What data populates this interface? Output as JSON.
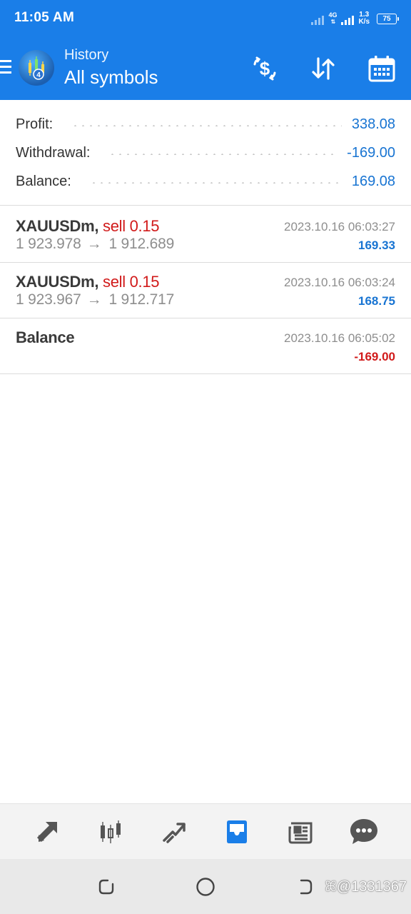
{
  "status_bar": {
    "time": "11:05 AM",
    "network": "4G",
    "speed_value": "1.3",
    "speed_unit": "K/s",
    "battery": "75"
  },
  "app_bar": {
    "subtitle": "History",
    "title": "All symbols",
    "icons": [
      "menu-icon",
      "app-logo",
      "deposit-dollar-icon",
      "sort-icon",
      "calendar-icon"
    ]
  },
  "summary": {
    "rows": [
      {
        "label": "Profit:",
        "value": "338.08"
      },
      {
        "label": "Withdrawal:",
        "value": "-169.00"
      },
      {
        "label": "Balance:",
        "value": "169.08"
      }
    ]
  },
  "deals": [
    {
      "symbol": "XAUUSDm,",
      "type": "sell 0.15",
      "open_price": "1 923.978",
      "arrow": "→",
      "close_price": "1 912.689",
      "time": "2023.10.16 06:03:27",
      "profit": "169.33"
    },
    {
      "symbol": "XAUUSDm,",
      "type": "sell 0.15",
      "open_price": "1 923.967",
      "arrow": "→",
      "close_price": "1 912.717",
      "time": "2023.10.16 06:03:24",
      "profit": "168.75"
    },
    {
      "symbol": "Balance",
      "type": "",
      "open_price": "",
      "arrow": "",
      "close_price": "",
      "time": "2023.10.16 06:05:02",
      "profit": "-169.00"
    }
  ],
  "bottom_nav": {
    "items": [
      "quotes-icon",
      "chart-icon",
      "trade-icon",
      "history-icon",
      "news-icon",
      "chat-icon"
    ],
    "active": "history-icon",
    "active_color": "#1a7ee8"
  },
  "system_nav": {
    "buttons": [
      "recent-apps-icon",
      "home-icon",
      "back-icon"
    ],
    "watermark": "@1331367"
  },
  "colors": {
    "accent": "#1a7ee8",
    "positive": "#1874d2",
    "negative": "#d11a1a"
  }
}
